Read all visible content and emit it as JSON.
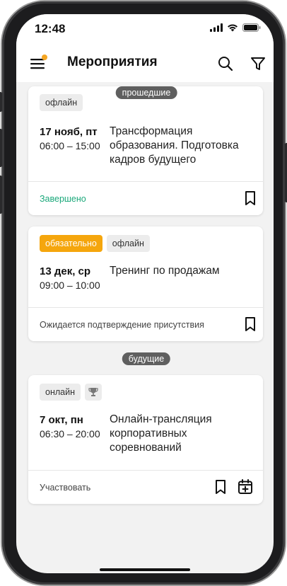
{
  "status_bar": {
    "time": "12:48"
  },
  "app_bar": {
    "title": "Мероприятия",
    "has_notification_dot": true
  },
  "sections": {
    "past_label": "прошедшие",
    "future_label": "будущие"
  },
  "events": [
    {
      "tags": [
        "офлайн"
      ],
      "date": "17 нояб, пт",
      "hours": "06:00 – 15:00",
      "name": "Трансформация образования. Подготовка кадров будущего",
      "status": "Завершено"
    },
    {
      "tags": [
        "обязательно",
        "офлайн"
      ],
      "date": "13 дек, ср",
      "hours": "09:00 – 10:00",
      "name": "Тренинг по продажам",
      "status": "Ожидается подтверждение присутствия"
    },
    {
      "tags": [
        "онлайн"
      ],
      "has_trophy": true,
      "date": "7 окт, пн",
      "hours": "06:30 – 20:00",
      "name": "Онлайн-трансляция корпоративных соревнований",
      "status": "Участвовать"
    }
  ],
  "colors": {
    "accent_orange": "#f5a60d",
    "status_green": "#1aa87a",
    "background": "#f2f2f2",
    "pill_gray": "#5f5f5f"
  }
}
